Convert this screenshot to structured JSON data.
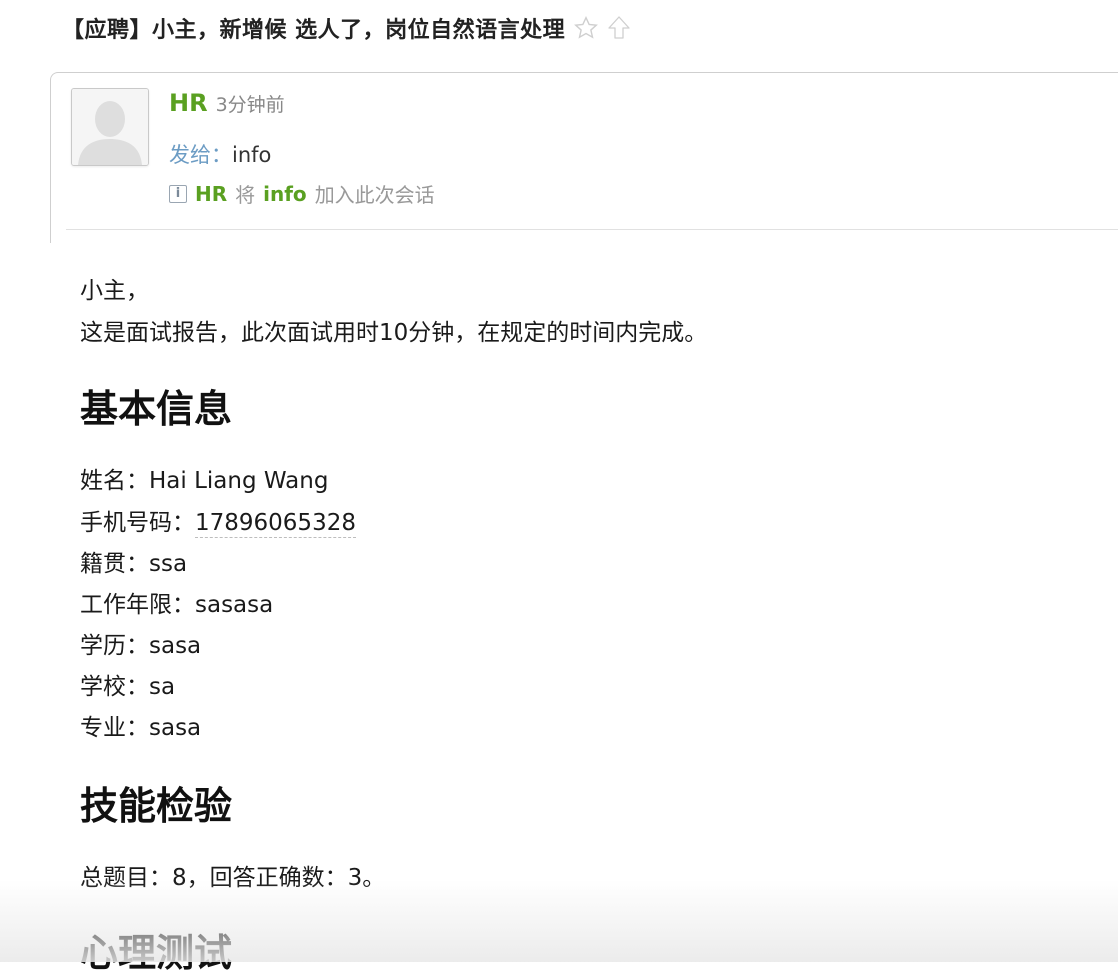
{
  "subject": {
    "title": "【应聘】小主，新增候 选人了，岗位自然语言处理",
    "star_icon": "star-outline-icon",
    "up_icon": "arrow-up-outline-icon"
  },
  "header": {
    "avatar_icon": "default-avatar-icon",
    "sender": "HR",
    "time": "3分钟前",
    "to_label": "发给：",
    "to_value": "info",
    "info_icon": "info-icon",
    "notice_sender": "HR",
    "notice_mid": "将",
    "notice_target": "info",
    "notice_action": "加入此次会话"
  },
  "body": {
    "greeting": "小主，",
    "intro": "这是面试报告，此次面试用时10分钟，在规定的时间内完成。",
    "section_basic": "基本信息",
    "fields": [
      {
        "label": "姓名：",
        "value": "Hai Liang Wang"
      },
      {
        "label": "手机号码：",
        "value": "17896065328"
      },
      {
        "label": "籍贯：",
        "value": "ssa"
      },
      {
        "label": "工作年限：",
        "value": "sasasa"
      },
      {
        "label": "学历：",
        "value": "sasa"
      },
      {
        "label": "学校：",
        "value": "sa"
      },
      {
        "label": "专业：",
        "value": "sasa"
      }
    ],
    "section_skills": "技能检验",
    "skills_summary": "总题目：8，回答正确数：3。",
    "section_psych": "心理测试"
  },
  "colors": {
    "sender_green": "#5aa021",
    "to_label_blue": "#6c9cc4",
    "muted_gray": "#999999"
  }
}
